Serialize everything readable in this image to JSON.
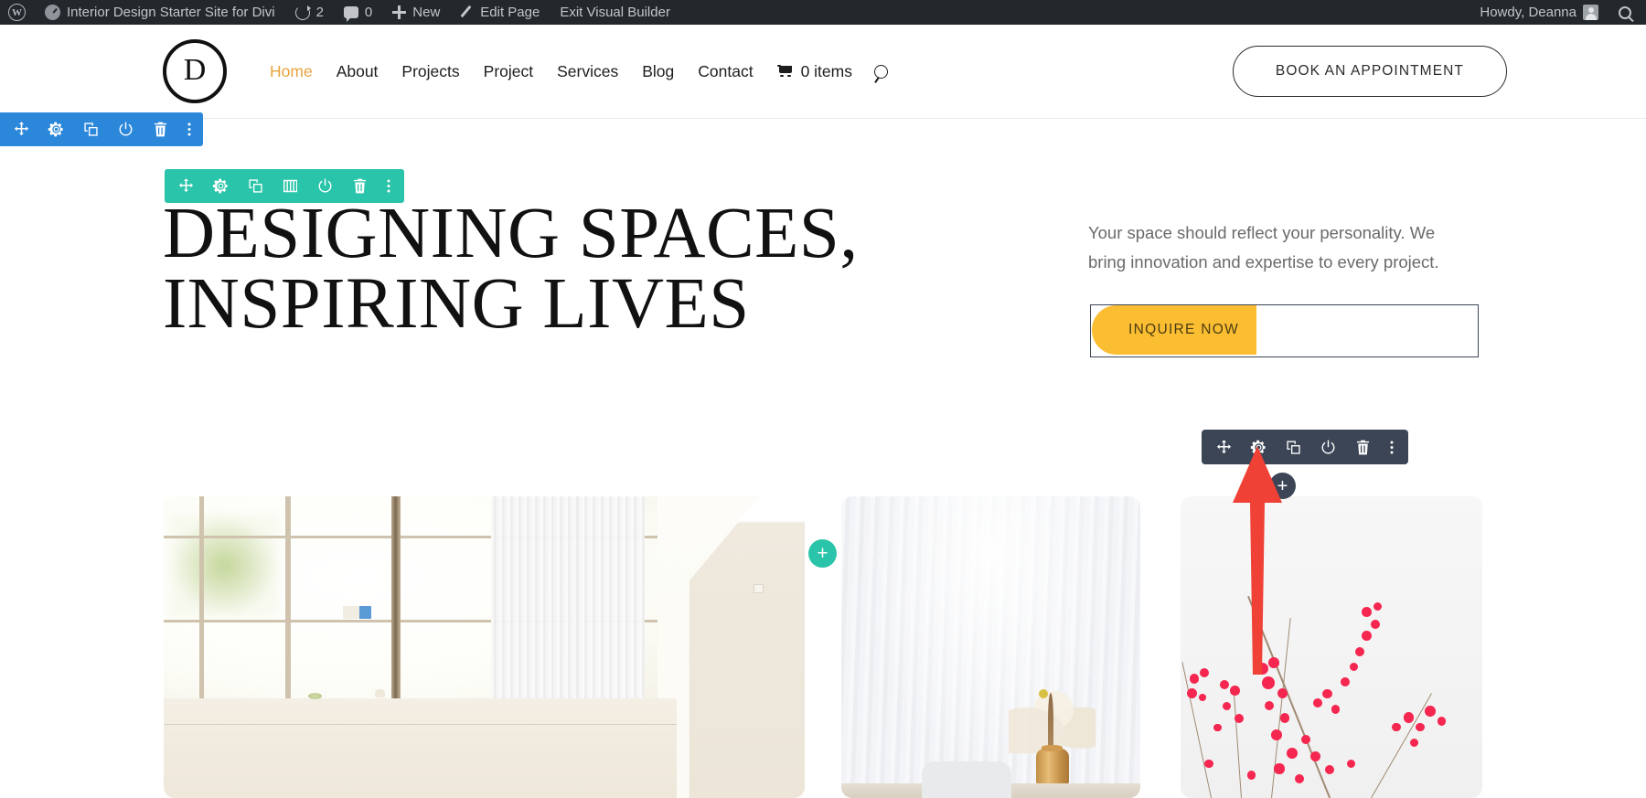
{
  "admin_bar": {
    "items": [
      {
        "name": "wp-logo",
        "label": ""
      },
      {
        "name": "site-name",
        "label": "Interior Design Starter Site for Divi"
      },
      {
        "name": "revisions",
        "label": "2"
      },
      {
        "name": "comments",
        "label": "0"
      },
      {
        "name": "new",
        "label": "New"
      },
      {
        "name": "edit-page",
        "label": "Edit Page"
      },
      {
        "name": "exit-visual-builder",
        "label": "Exit Visual Builder"
      }
    ],
    "site_name": "Interior Design Starter Site for Divi",
    "revisions_count": "2",
    "comments_count": "0",
    "new_label": "New",
    "edit_page_label": "Edit Page",
    "exit_builder_label": "Exit Visual Builder",
    "howdy": "Howdy, Deanna"
  },
  "site_header": {
    "logo_letter": "D",
    "nav": [
      {
        "label": "Home",
        "active": true
      },
      {
        "label": "About",
        "active": false
      },
      {
        "label": "Projects",
        "active": false
      },
      {
        "label": "Project",
        "active": false
      },
      {
        "label": "Services",
        "active": false
      },
      {
        "label": "Blog",
        "active": false
      },
      {
        "label": "Contact",
        "active": false
      }
    ],
    "cart_label": "0 items",
    "cta_label": "BOOK AN APPOINTMENT"
  },
  "hero": {
    "title": "DESIGNING SPACES, INSPIRING LIVES",
    "title_line1": "DESIGNING SPACES,",
    "title_line2": "INSPIRING LIVES",
    "subtitle": "Your space should reflect your personality. We bring innovation and expertise to every project.",
    "button_label": "INQUIRE NOW"
  },
  "builder": {
    "section_toolbar": {
      "color": "#2b87da",
      "icons": [
        "move-icon",
        "gear-icon",
        "duplicate-icon",
        "power-icon",
        "trash-icon",
        "more-options-icon"
      ]
    },
    "row_toolbar": {
      "color": "#29c4a9",
      "icons": [
        "move-icon",
        "gear-icon",
        "duplicate-icon",
        "columns-icon",
        "power-icon",
        "trash-icon",
        "more-options-icon"
      ]
    },
    "module_toolbar": {
      "color": "#3b4555",
      "icons": [
        "move-icon",
        "gear-icon",
        "duplicate-icon",
        "power-icon",
        "trash-icon",
        "more-options-icon"
      ],
      "active_icon": "gear-icon"
    },
    "add_row_label": "+",
    "add_module_label": "+"
  },
  "gallery": {
    "images": [
      {
        "name": "loft-window-interior-photo",
        "alt": "Bright loft interior with large grid window and white brick wall"
      },
      {
        "name": "curtain-vase-photo",
        "alt": "Sheer white curtain behind a wooden vase with dried pampas grass"
      },
      {
        "name": "red-berries-photo",
        "alt": "Red berry branches against a white background"
      }
    ]
  },
  "annotation": {
    "arrow_color": "#ef4136",
    "points_at": "gear-icon"
  },
  "colors": {
    "admin_bar": "#23282d",
    "section_blue": "#2b87da",
    "row_teal": "#29c4a9",
    "module_dark": "#3b4555",
    "button_yellow": "#fbbe33",
    "nav_active": "#e8a33d",
    "arrow_red": "#ef4136"
  }
}
